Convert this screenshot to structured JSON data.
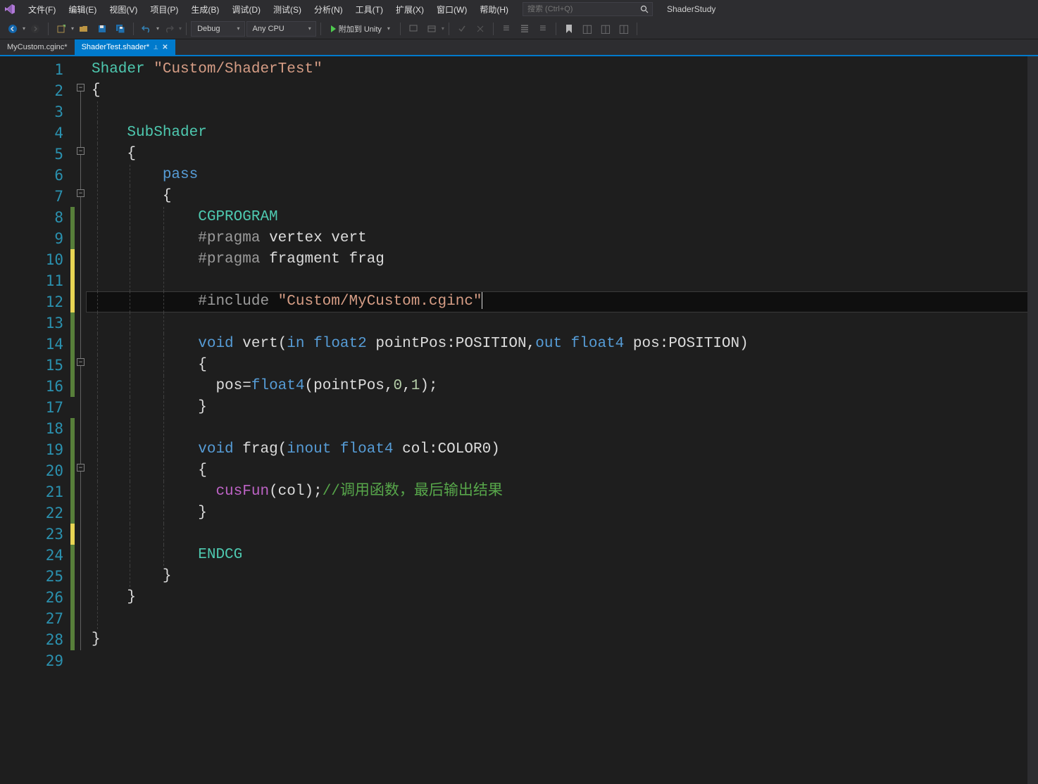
{
  "solution_name": "ShaderStudy",
  "search": {
    "placeholder": "搜索 (Ctrl+Q)"
  },
  "menu": {
    "file": "文件(F)",
    "edit": "编辑(E)",
    "view": "视图(V)",
    "project": "项目(P)",
    "build": "生成(B)",
    "debug": "调试(D)",
    "test": "测试(S)",
    "analyze": "分析(N)",
    "tools": "工具(T)",
    "extensions": "扩展(X)",
    "window": "窗口(W)",
    "help": "帮助(H)"
  },
  "toolbar": {
    "config": "Debug",
    "platform": "Any CPU",
    "run_label": "附加到 Unity"
  },
  "tabs": {
    "inactive_label": "MyCustom.cginc*",
    "active_label": "ShaderTest.shader*"
  },
  "code": {
    "lines": [
      "1",
      "2",
      "3",
      "4",
      "5",
      "6",
      "7",
      "8",
      "9",
      "10",
      "11",
      "12",
      "13",
      "14",
      "15",
      "16",
      "17",
      "18",
      "19",
      "20",
      "21",
      "22",
      "23",
      "24",
      "25",
      "26",
      "27",
      "28",
      "29"
    ],
    "tokens": {
      "Shader": "Shader",
      "shader_name": "\"Custom/ShaderTest\"",
      "SubShader": "SubShader",
      "pass": "pass",
      "lbrace": "{",
      "rbrace": "}",
      "CGPROGRAM": "CGPROGRAM",
      "ENDCG": "ENDCG",
      "pragma": "#pragma",
      "vertex": "vertex",
      "vert": "vert",
      "fragment": "fragment",
      "frag": "frag",
      "include": "#include",
      "include_path": "\"Custom/MyCustom.cginc\"",
      "void": "void",
      "in": "in",
      "out": "out",
      "inout": "inout",
      "float2": "float2",
      "float4": "float4",
      "pointPos": "pointPos",
      "pos": "pos",
      "col": "col",
      "POSITION": "POSITION",
      "COLOR0": "COLOR0",
      "zero": "0",
      "one": "1",
      "cusFun": "cusFun",
      "comment": "//调用函数，最后输出结果"
    }
  }
}
